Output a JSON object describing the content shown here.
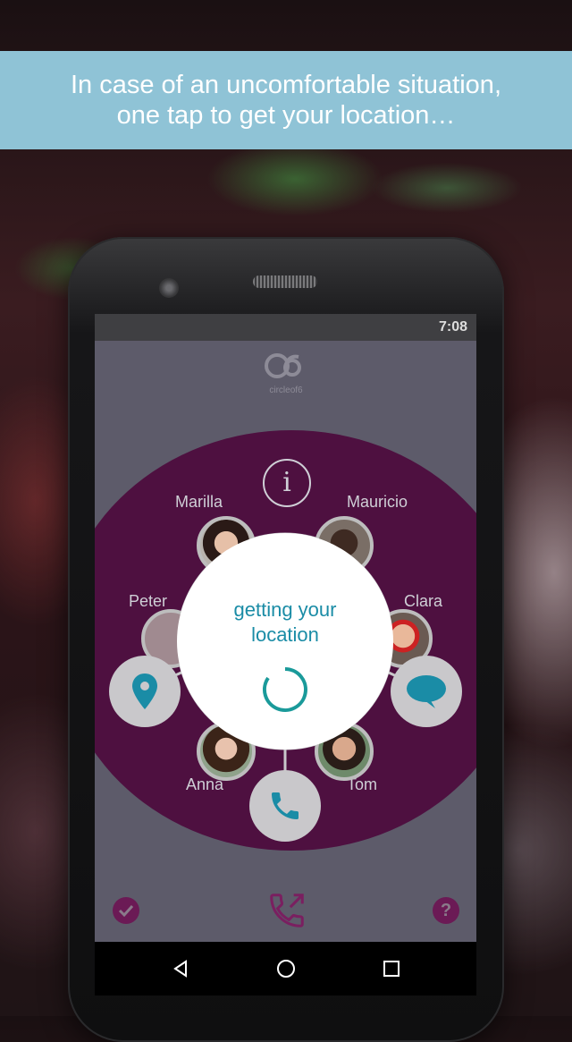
{
  "banner": {
    "line1": "In case of an uncomfortable situation,",
    "line2": "one tap to get your location…"
  },
  "status": {
    "time": "7:08"
  },
  "app": {
    "logo_text": "circleof6"
  },
  "contacts": [
    {
      "name": "Marilla"
    },
    {
      "name": "Mauricio"
    },
    {
      "name": "Peter"
    },
    {
      "name": "Clara"
    },
    {
      "name": "Anna"
    },
    {
      "name": "Tom"
    }
  ],
  "popup": {
    "text": "getting your location"
  },
  "colors": {
    "disc": "#4e1040",
    "accent": "#1a8ca6",
    "banner": "#8fc3d6"
  }
}
